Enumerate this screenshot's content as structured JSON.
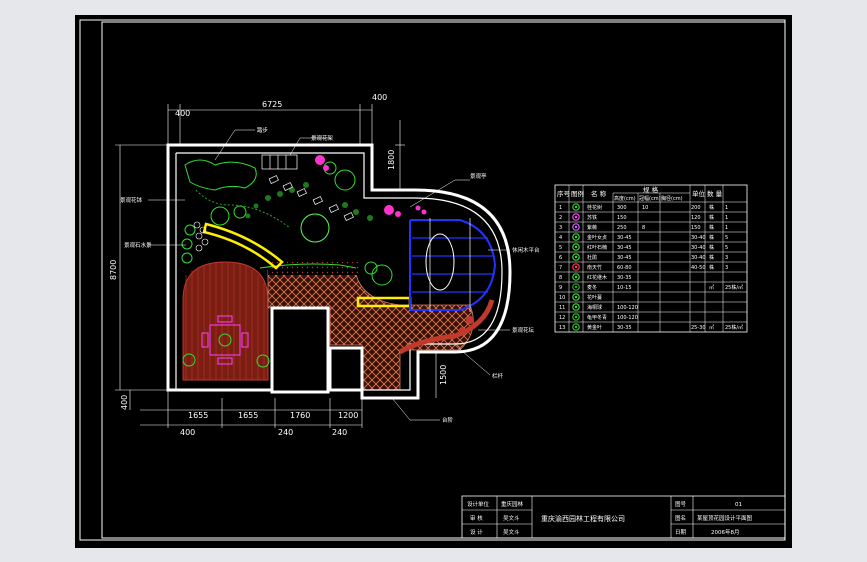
{
  "dimensions": {
    "top_width": "6725",
    "top_left_offset": "400",
    "top_right_offset": "400",
    "right_height": "1800",
    "left_height": "8700",
    "bottom_left_offset": "400",
    "bottom_right_height": "1500",
    "bottom_segments": [
      "1655",
      "1655",
      "1760",
      "1200"
    ],
    "bottom_offsets": [
      "400",
      "240",
      "240"
    ]
  },
  "callouts": {
    "top_a": "踏步",
    "top_b": "景观花架",
    "left_a": "景观花钵",
    "left_b": "景观石水景",
    "right_a": "景观亭",
    "right_b": "休闲木平台",
    "right_c": "景观花坛",
    "right_d": "栏杆",
    "bottom": "台阶"
  },
  "plant_table": {
    "headers": [
      "序号",
      "图例",
      "名 称",
      "规 格",
      "单位",
      "数 量"
    ],
    "sub_headers": [
      "高度(cm)",
      "冠幅(cm)",
      "胸径(cm)"
    ],
    "rows": [
      {
        "no": "1",
        "name": "桂花树",
        "h": "300",
        "c": "",
        "d": "10",
        "w": "200",
        "unit": "株",
        "qty": "1"
      },
      {
        "no": "2",
        "name": "苏铁",
        "h": "150",
        "c": "",
        "d": "",
        "w": "120",
        "unit": "株",
        "qty": "1"
      },
      {
        "no": "3",
        "name": "紫薇",
        "h": "250",
        "c": "",
        "d": "8",
        "w": "150",
        "unit": "株",
        "qty": "1"
      },
      {
        "no": "4",
        "name": "金叶女贞",
        "h": "30-45",
        "c": "",
        "d": "",
        "w": "30-40",
        "unit": "株",
        "qty": "5"
      },
      {
        "no": "5",
        "name": "红叶石楠",
        "h": "30-45",
        "c": "",
        "d": "",
        "w": "30-40",
        "unit": "株",
        "qty": "5"
      },
      {
        "no": "6",
        "name": "杜鹃",
        "h": "30-45",
        "c": "",
        "d": "",
        "w": "30-40",
        "unit": "株",
        "qty": "3"
      },
      {
        "no": "7",
        "name": "南天竹",
        "h": "60-80",
        "c": "",
        "d": "",
        "w": "40-50",
        "unit": "株",
        "qty": "3"
      },
      {
        "no": "8",
        "name": "红花继木",
        "h": "30-35",
        "c": "",
        "d": "",
        "w": "",
        "unit": "",
        "qty": ""
      },
      {
        "no": "9",
        "name": "麦冬",
        "h": "10-15",
        "c": "",
        "d": "",
        "w": "",
        "unit": "㎡",
        "qty": "25株/㎡"
      },
      {
        "no": "10",
        "name": "花叶蔓",
        "h": "",
        "c": "",
        "d": "",
        "w": "",
        "unit": "",
        "qty": ""
      },
      {
        "no": "11",
        "name": "海桐球",
        "h": "100-120",
        "c": "",
        "d": "",
        "w": "",
        "unit": "",
        "qty": ""
      },
      {
        "no": "12",
        "name": "龟甲冬青",
        "h": "100-120",
        "c": "",
        "d": "",
        "w": "",
        "unit": "",
        "qty": ""
      },
      {
        "no": "13",
        "name": "黄金叶",
        "h": "30-35",
        "c": "",
        "d": "",
        "w": "25-30",
        "unit": "㎡",
        "qty": "25株/㎡"
      }
    ],
    "legend_colors": [
      "#32d232",
      "#ff44ff",
      "#cc66ff",
      "#33dd33",
      "#33dd33",
      "#33dd33",
      "#ff3355",
      "#33dd33",
      "#22aa22",
      "#33dd33",
      "#33dd33",
      "#22cc22",
      "#22cc22"
    ]
  },
  "title_block": {
    "company": "重庆渝西园林工程有限公司",
    "labels": [
      "设计单位",
      "审 核",
      "设 计"
    ],
    "values": [
      "重庆园林",
      "吴文斗",
      "吴文斗"
    ],
    "right_labels": [
      "图号",
      "图名",
      "日期"
    ],
    "right_values": [
      "01",
      "某屋顶花园设计平面图",
      "2006年8月"
    ]
  },
  "colors": {
    "wall": "#ffffff",
    "deck": "#c0392b",
    "paving": "#e07a5f",
    "plant_green": "#33dd33",
    "accent_yellow": "#ffee00",
    "pergola_blue": "#2233ff",
    "flower_magenta": "#ff33cc"
  }
}
